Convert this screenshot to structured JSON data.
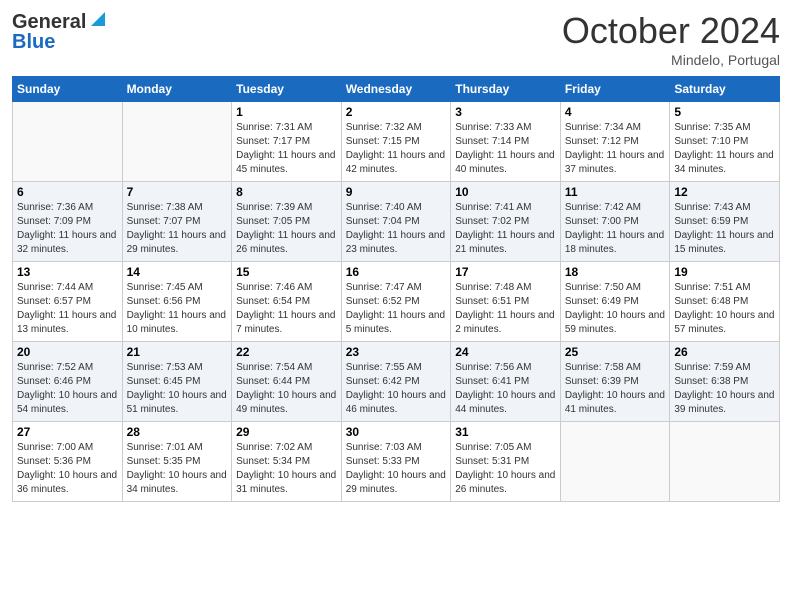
{
  "header": {
    "logo_line1": "General",
    "logo_line2": "Blue",
    "month": "October 2024",
    "location": "Mindelo, Portugal"
  },
  "weekdays": [
    "Sunday",
    "Monday",
    "Tuesday",
    "Wednesday",
    "Thursday",
    "Friday",
    "Saturday"
  ],
  "weeks": [
    [
      {
        "day": "",
        "sunrise": "",
        "sunset": "",
        "daylight": ""
      },
      {
        "day": "",
        "sunrise": "",
        "sunset": "",
        "daylight": ""
      },
      {
        "day": "1",
        "sunrise": "Sunrise: 7:31 AM",
        "sunset": "Sunset: 7:17 PM",
        "daylight": "Daylight: 11 hours and 45 minutes."
      },
      {
        "day": "2",
        "sunrise": "Sunrise: 7:32 AM",
        "sunset": "Sunset: 7:15 PM",
        "daylight": "Daylight: 11 hours and 42 minutes."
      },
      {
        "day": "3",
        "sunrise": "Sunrise: 7:33 AM",
        "sunset": "Sunset: 7:14 PM",
        "daylight": "Daylight: 11 hours and 40 minutes."
      },
      {
        "day": "4",
        "sunrise": "Sunrise: 7:34 AM",
        "sunset": "Sunset: 7:12 PM",
        "daylight": "Daylight: 11 hours and 37 minutes."
      },
      {
        "day": "5",
        "sunrise": "Sunrise: 7:35 AM",
        "sunset": "Sunset: 7:10 PM",
        "daylight": "Daylight: 11 hours and 34 minutes."
      }
    ],
    [
      {
        "day": "6",
        "sunrise": "Sunrise: 7:36 AM",
        "sunset": "Sunset: 7:09 PM",
        "daylight": "Daylight: 11 hours and 32 minutes."
      },
      {
        "day": "7",
        "sunrise": "Sunrise: 7:38 AM",
        "sunset": "Sunset: 7:07 PM",
        "daylight": "Daylight: 11 hours and 29 minutes."
      },
      {
        "day": "8",
        "sunrise": "Sunrise: 7:39 AM",
        "sunset": "Sunset: 7:05 PM",
        "daylight": "Daylight: 11 hours and 26 minutes."
      },
      {
        "day": "9",
        "sunrise": "Sunrise: 7:40 AM",
        "sunset": "Sunset: 7:04 PM",
        "daylight": "Daylight: 11 hours and 23 minutes."
      },
      {
        "day": "10",
        "sunrise": "Sunrise: 7:41 AM",
        "sunset": "Sunset: 7:02 PM",
        "daylight": "Daylight: 11 hours and 21 minutes."
      },
      {
        "day": "11",
        "sunrise": "Sunrise: 7:42 AM",
        "sunset": "Sunset: 7:00 PM",
        "daylight": "Daylight: 11 hours and 18 minutes."
      },
      {
        "day": "12",
        "sunrise": "Sunrise: 7:43 AM",
        "sunset": "Sunset: 6:59 PM",
        "daylight": "Daylight: 11 hours and 15 minutes."
      }
    ],
    [
      {
        "day": "13",
        "sunrise": "Sunrise: 7:44 AM",
        "sunset": "Sunset: 6:57 PM",
        "daylight": "Daylight: 11 hours and 13 minutes."
      },
      {
        "day": "14",
        "sunrise": "Sunrise: 7:45 AM",
        "sunset": "Sunset: 6:56 PM",
        "daylight": "Daylight: 11 hours and 10 minutes."
      },
      {
        "day": "15",
        "sunrise": "Sunrise: 7:46 AM",
        "sunset": "Sunset: 6:54 PM",
        "daylight": "Daylight: 11 hours and 7 minutes."
      },
      {
        "day": "16",
        "sunrise": "Sunrise: 7:47 AM",
        "sunset": "Sunset: 6:52 PM",
        "daylight": "Daylight: 11 hours and 5 minutes."
      },
      {
        "day": "17",
        "sunrise": "Sunrise: 7:48 AM",
        "sunset": "Sunset: 6:51 PM",
        "daylight": "Daylight: 11 hours and 2 minutes."
      },
      {
        "day": "18",
        "sunrise": "Sunrise: 7:50 AM",
        "sunset": "Sunset: 6:49 PM",
        "daylight": "Daylight: 10 hours and 59 minutes."
      },
      {
        "day": "19",
        "sunrise": "Sunrise: 7:51 AM",
        "sunset": "Sunset: 6:48 PM",
        "daylight": "Daylight: 10 hours and 57 minutes."
      }
    ],
    [
      {
        "day": "20",
        "sunrise": "Sunrise: 7:52 AM",
        "sunset": "Sunset: 6:46 PM",
        "daylight": "Daylight: 10 hours and 54 minutes."
      },
      {
        "day": "21",
        "sunrise": "Sunrise: 7:53 AM",
        "sunset": "Sunset: 6:45 PM",
        "daylight": "Daylight: 10 hours and 51 minutes."
      },
      {
        "day": "22",
        "sunrise": "Sunrise: 7:54 AM",
        "sunset": "Sunset: 6:44 PM",
        "daylight": "Daylight: 10 hours and 49 minutes."
      },
      {
        "day": "23",
        "sunrise": "Sunrise: 7:55 AM",
        "sunset": "Sunset: 6:42 PM",
        "daylight": "Daylight: 10 hours and 46 minutes."
      },
      {
        "day": "24",
        "sunrise": "Sunrise: 7:56 AM",
        "sunset": "Sunset: 6:41 PM",
        "daylight": "Daylight: 10 hours and 44 minutes."
      },
      {
        "day": "25",
        "sunrise": "Sunrise: 7:58 AM",
        "sunset": "Sunset: 6:39 PM",
        "daylight": "Daylight: 10 hours and 41 minutes."
      },
      {
        "day": "26",
        "sunrise": "Sunrise: 7:59 AM",
        "sunset": "Sunset: 6:38 PM",
        "daylight": "Daylight: 10 hours and 39 minutes."
      }
    ],
    [
      {
        "day": "27",
        "sunrise": "Sunrise: 7:00 AM",
        "sunset": "Sunset: 5:36 PM",
        "daylight": "Daylight: 10 hours and 36 minutes."
      },
      {
        "day": "28",
        "sunrise": "Sunrise: 7:01 AM",
        "sunset": "Sunset: 5:35 PM",
        "daylight": "Daylight: 10 hours and 34 minutes."
      },
      {
        "day": "29",
        "sunrise": "Sunrise: 7:02 AM",
        "sunset": "Sunset: 5:34 PM",
        "daylight": "Daylight: 10 hours and 31 minutes."
      },
      {
        "day": "30",
        "sunrise": "Sunrise: 7:03 AM",
        "sunset": "Sunset: 5:33 PM",
        "daylight": "Daylight: 10 hours and 29 minutes."
      },
      {
        "day": "31",
        "sunrise": "Sunrise: 7:05 AM",
        "sunset": "Sunset: 5:31 PM",
        "daylight": "Daylight: 10 hours and 26 minutes."
      },
      {
        "day": "",
        "sunrise": "",
        "sunset": "",
        "daylight": ""
      },
      {
        "day": "",
        "sunrise": "",
        "sunset": "",
        "daylight": ""
      }
    ]
  ]
}
